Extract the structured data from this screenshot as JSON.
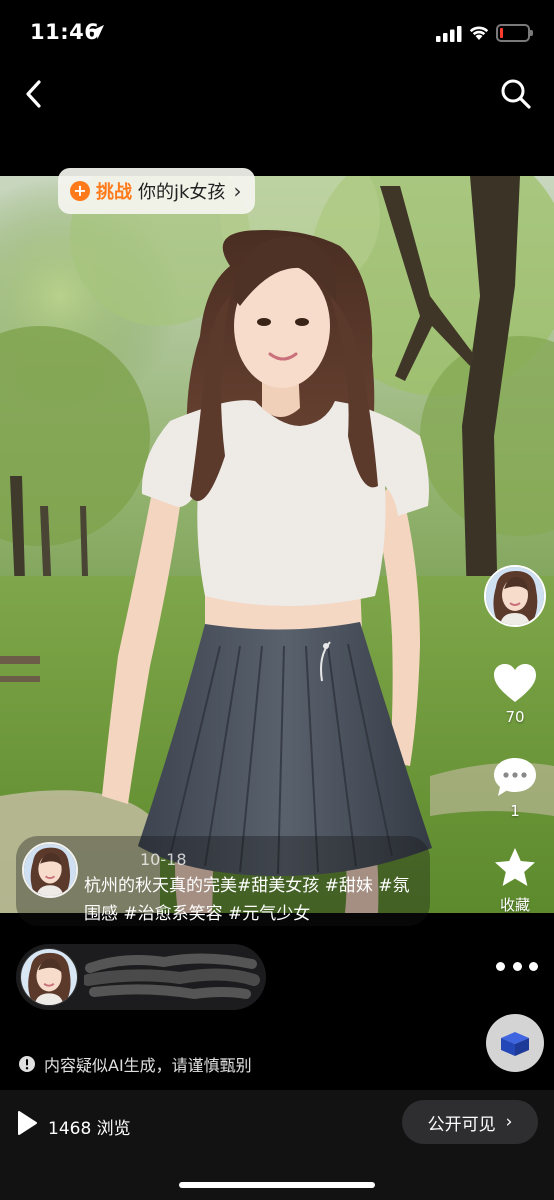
{
  "status_bar": {
    "time": "11:46",
    "battery_color": "#ff3b30"
  },
  "nav": {
    "back_icon": "chevron-left-icon",
    "search_icon": "search-icon"
  },
  "challenge": {
    "tag": "挑战",
    "topic": "你的jk女孩",
    "chevron": "›",
    "accent": "#ff7a1a"
  },
  "actions": {
    "likes": "70",
    "comments": "1",
    "favorite_label": "收藏"
  },
  "post": {
    "date": "10-18",
    "caption_prefix": "杭州的秋天真的完美",
    "tags": "#甜美女孩 #甜妹 #氛围感 #治愈系笑容 #元气少女"
  },
  "notice": {
    "text": "内容疑似AI生成，请谨慎甄别"
  },
  "bottom": {
    "views": "1468 浏览",
    "visibility_label": "公开可见",
    "visibility_chevron": "›"
  }
}
